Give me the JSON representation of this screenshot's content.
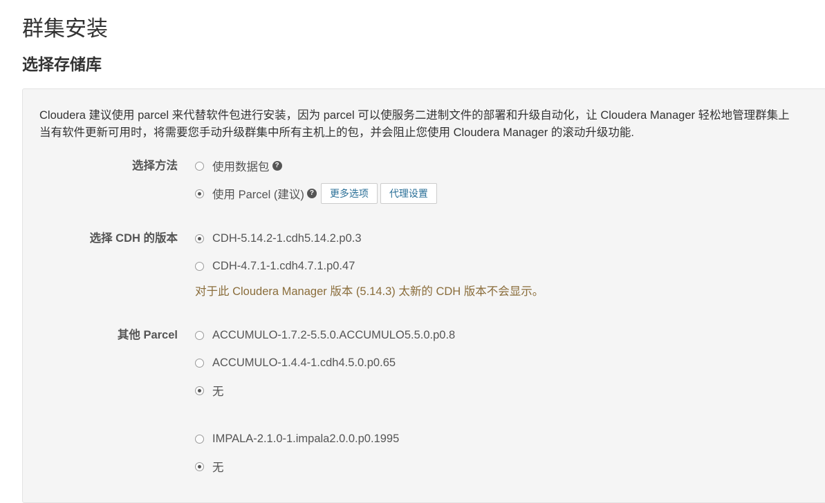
{
  "page": {
    "title": "群集安装",
    "subtitle": "选择存储库"
  },
  "intro": {
    "line1": "Cloudera 建议使用 parcel 来代替软件包进行安装，因为 parcel 可以使服务二进制文件的部署和升级自动化，让 Cloudera Manager 轻松地管理群集上",
    "line2": "当有软件更新可用时，将需要您手动升级群集中所有主机上的包，并会阻止您使用 Cloudera Manager 的滚动升级功能."
  },
  "method": {
    "label": "选择方法",
    "options": [
      {
        "label": "使用数据包",
        "checked": false
      },
      {
        "label": "使用 Parcel (建议)",
        "checked": true
      }
    ],
    "more_options_label": "更多选项",
    "proxy_settings_label": "代理设置",
    "help_glyph": "?"
  },
  "cdh": {
    "label": "选择 CDH 的版本",
    "options": [
      {
        "label": "CDH-5.14.2-1.cdh5.14.2.p0.3",
        "checked": true
      },
      {
        "label": "CDH-4.7.1-1.cdh4.7.1.p0.47",
        "checked": false
      }
    ],
    "note": "对于此 Cloudera Manager 版本 (5.14.3) 太新的 CDH 版本不会显示。"
  },
  "other": {
    "label": "其他 Parcel",
    "groups": [
      [
        {
          "label": "ACCUMULO-1.7.2-5.5.0.ACCUMULO5.5.0.p0.8",
          "checked": false
        },
        {
          "label": "ACCUMULO-1.4.4-1.cdh4.5.0.p0.65",
          "checked": false
        },
        {
          "label": "无",
          "checked": true
        }
      ],
      [
        {
          "label": "IMPALA-2.1.0-1.impala2.0.0.p0.1995",
          "checked": false
        },
        {
          "label": "无",
          "checked": true
        }
      ]
    ]
  },
  "colors": {
    "panel_bg": "#f5f5f5",
    "link_blue": "#2a6f97",
    "note_brown": "#8a6d3b"
  }
}
